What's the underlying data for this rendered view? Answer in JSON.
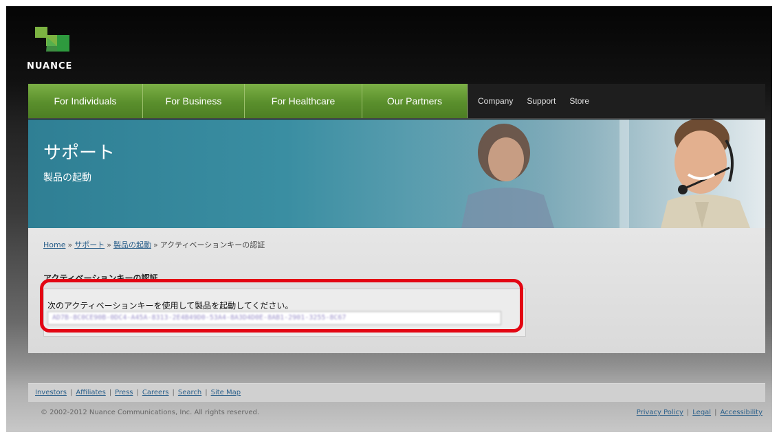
{
  "brand": {
    "name": "NUANCE"
  },
  "nav": {
    "main": [
      "For Individuals",
      "For Business",
      "For Healthcare",
      "Our Partners"
    ],
    "secondary": [
      "Company",
      "Support",
      "Store"
    ]
  },
  "hero": {
    "title": "サポート",
    "subtitle": "製品の起動"
  },
  "breadcrumb": {
    "home": "Home",
    "support": "サポート",
    "activation": "製品の起動",
    "current": "アクティベーションキーの認証",
    "separator": "»"
  },
  "main": {
    "heading": "アクティベーションキーの認証",
    "instruction": "次のアクティベーションキーを使用して製品を起動してください。",
    "key_value": "AD7B-8C0CE90B-0DC4-A45A-8313-2E4B49D0-53A4-8A3D4D0E-8AB1-2901-3255-8C67"
  },
  "footer": {
    "links": [
      "Investors",
      "Affiliates",
      "Press",
      "Careers",
      "Search",
      "Site Map"
    ],
    "copyright": "© 2002-2012 Nuance Communications, Inc. All rights reserved.",
    "legal_links": [
      "Privacy Policy",
      "Legal",
      "Accessibility"
    ],
    "separator": "|"
  },
  "colors": {
    "nav_green": "#5a8f2c",
    "hero_teal": "#2f7f94",
    "highlight_red": "#e30613",
    "link_blue": "#2a5f8a"
  }
}
